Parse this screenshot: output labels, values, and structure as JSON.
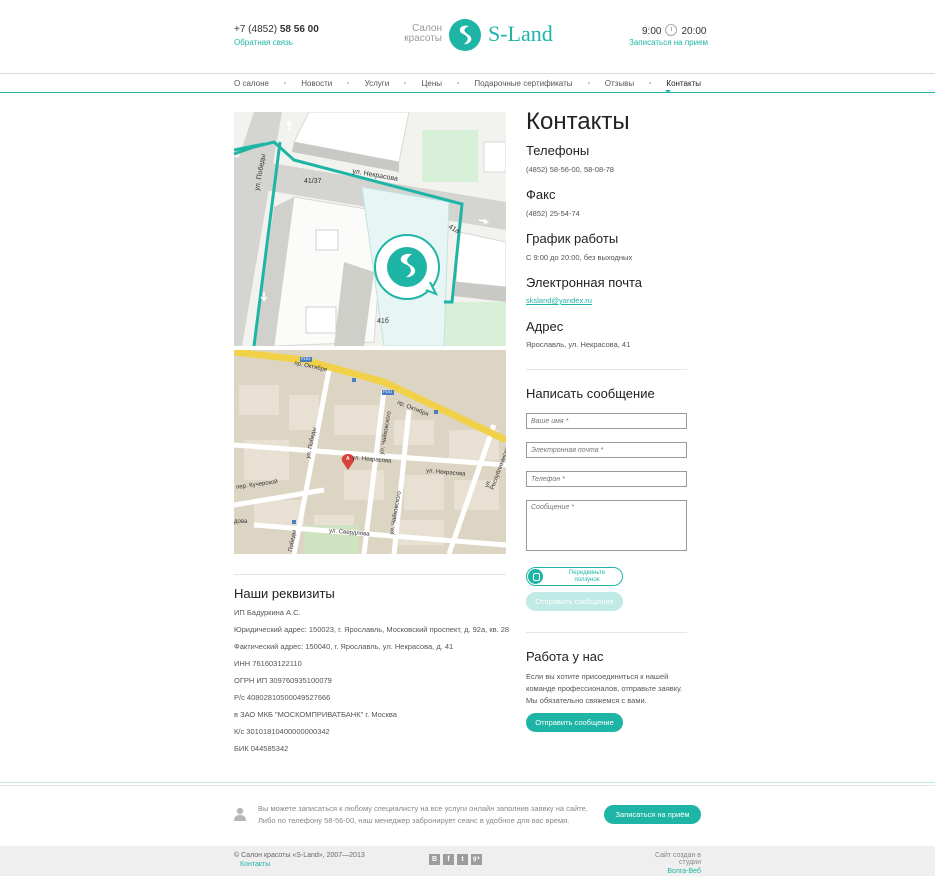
{
  "header": {
    "phone_prefix": "+7 (4852)",
    "phone_main": "58 56 00",
    "callback_label": "Обратная связь",
    "logo_small_line1": "Салон",
    "logo_small_line2": "красоты",
    "logo_word": "S-Land",
    "hours_open": "9:00",
    "hours_close": "20:00",
    "appointment_link": "Записаться на прием"
  },
  "nav": {
    "items": [
      "О салоне",
      "Новости",
      "Услуги",
      "Цены",
      "Подарочные сертификаты",
      "Отзывы",
      "Контакты"
    ],
    "active": "Контакты"
  },
  "map_top": {
    "street_label": "ул. Некрасова",
    "street_side_label": "ул. Победы",
    "building_1": "41/37",
    "building_2": "41а",
    "building_3": "41б"
  },
  "map_bottom": {
    "labels": [
      "пр. Октября",
      "пр. Октября",
      "ул. Победы",
      "ул. Некрасова",
      "ул. Некрасова",
      "пер. Кучерской",
      "ул. Чайковского",
      "ул. Чайковского",
      "ул. Республиканская",
      "ул. Свердлова",
      "дова",
      "Победы",
      "Р151",
      "Р151"
    ],
    "marker": "A"
  },
  "contacts": {
    "title": "Контакты",
    "phones_title": "Телефоны",
    "phones_value": "(4852) 58-56-00, 58-08-78",
    "fax_title": "Факс",
    "fax_value": "(4852) 25-54-74",
    "schedule_title": "График работы",
    "schedule_value": "С 9:00 до 20:00, без выходных",
    "email_title": "Электронная почта",
    "email_value": "sksland@yandex.ru",
    "address_title": "Адрес",
    "address_value": "Ярославль, ул. Некрасова, 41"
  },
  "form": {
    "title": "Написать сообщение",
    "name_placeholder": "Ваше имя *",
    "email_placeholder": "Электронная почта *",
    "phone_placeholder": "Телефон *",
    "message_placeholder": "Сообщение *",
    "slider_line1": "Передвиньте",
    "slider_line2": "ползунок",
    "submit_label": "Отправить сообщение"
  },
  "jobs": {
    "title": "Работа у нас",
    "line1": "Если вы хотите присоединиться к нашей",
    "line2": "команде профессионалов, отправьте заявку.",
    "line3": "Мы обязательно свяжемся с вами.",
    "button_label": "Отправить сообщение"
  },
  "requisites": {
    "title": "Наши реквизиты",
    "lines": [
      "ИП Бадуркина А.С.",
      "Юридический адрес: 150023, г. Ярославль, Московский проспект, д. 92а, кв. 28",
      "Фактический адрес: 150040, г. Ярославль, ул. Некрасова, д. 41",
      "ИНН 761603122110",
      "ОГРН ИП 309760935100079",
      "Р/с 40802810500049527666",
      "в ЗАО МКБ \"МОСКОМПРИВАТБАНК\" г. Москва",
      "К/с 30101810400000000342",
      "БИК 044585342"
    ]
  },
  "cta": {
    "line1": "Вы можете записаться к любому специалисту на все услуги онлайн заполнив заявку на сайте.",
    "line2": "Либо по телефону 58-56-00, наш менеджер забронирует сеанс в удобное для вас время.",
    "button_label": "Записаться на приём"
  },
  "footer": {
    "copyright": "© Салон красоты «S-Land», 2007—2013",
    "contacts_link": "Контакты",
    "social": [
      "В",
      "f",
      "t",
      "g+"
    ],
    "studio_line": "Сайт создан в студии",
    "studio_link": "Волга-Веб"
  },
  "colors": {
    "accent": "#1fb5a6",
    "nav_line": "#d8d8d8",
    "footer_bg": "#efefef"
  }
}
